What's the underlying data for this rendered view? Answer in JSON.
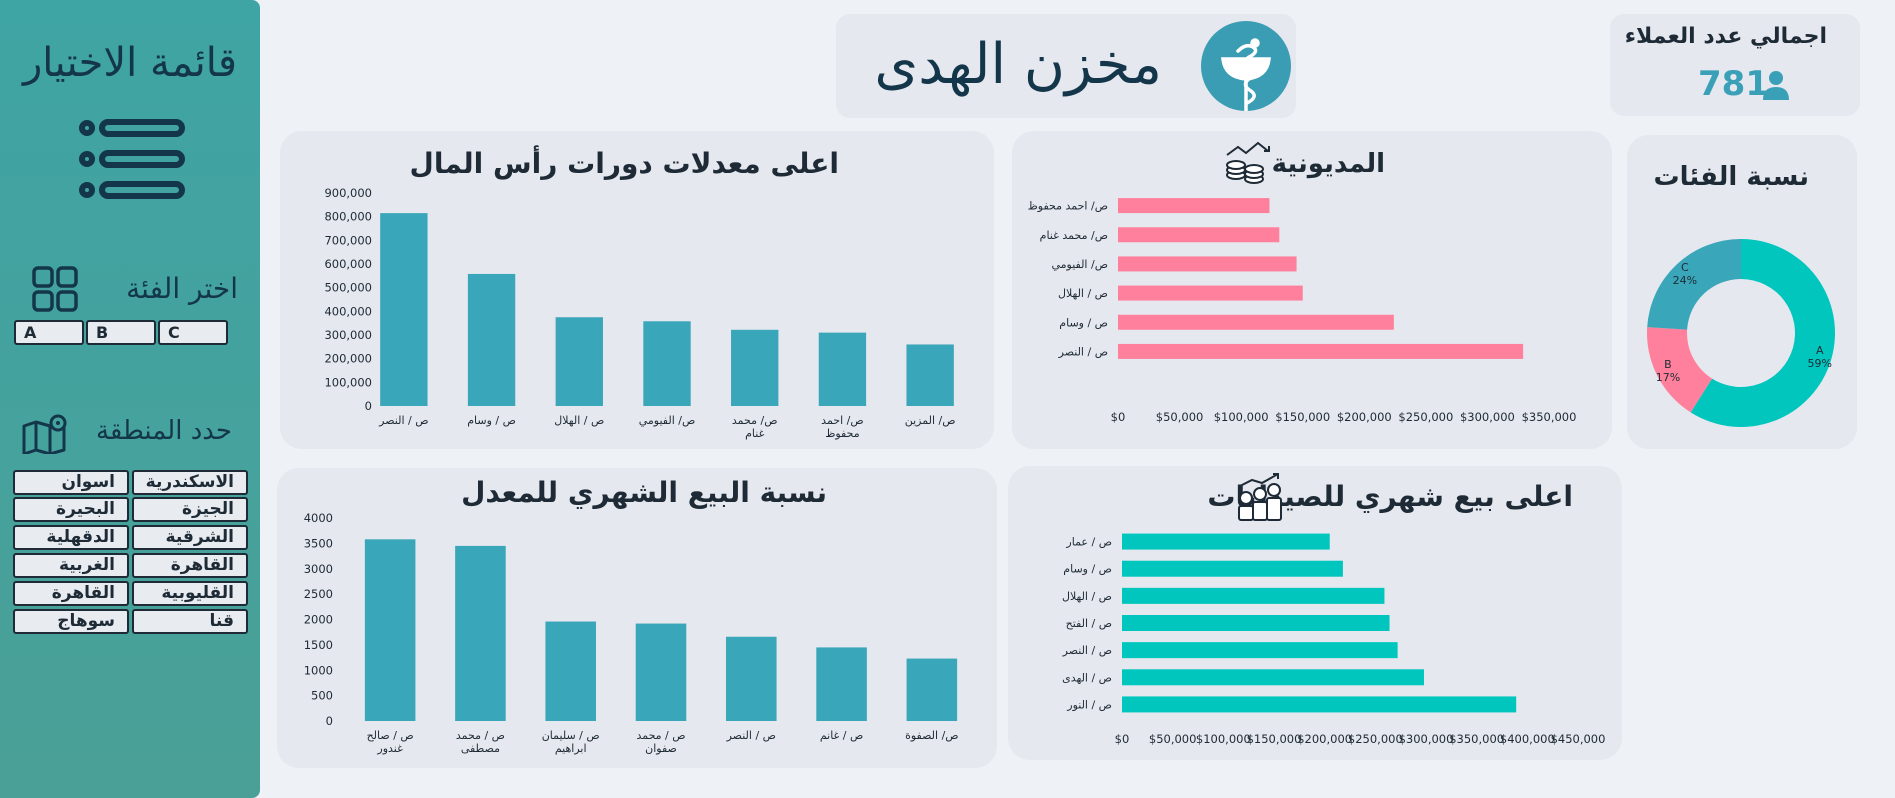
{
  "sidebar": {
    "title": "قائمة الاختيار",
    "category_title": "اختر الفئة",
    "categories": [
      "A",
      "B",
      "C"
    ],
    "region_title": "حدد المنطقة",
    "regions": [
      [
        "الاسكندرية",
        "اسوان"
      ],
      [
        "الجيزة",
        "البحيرة"
      ],
      [
        "الشرقية",
        "الدقهلية"
      ],
      [
        "القاهرة",
        "الغربية"
      ],
      [
        "القليوبية",
        "القاهرة"
      ],
      [
        "قنا",
        "سوهاج"
      ]
    ]
  },
  "header": {
    "title": "مخزن الهدى"
  },
  "kpi": {
    "label": "اجمالي عدد العملاء",
    "value": "781"
  },
  "colors": {
    "teal": "#3aa6b9",
    "pink": "#ff809c",
    "mint": "#00c6be",
    "sidebar": "#45a39d"
  },
  "chart_data": [
    {
      "id": "capital",
      "type": "bar",
      "title": "اعلى معدلات دورات رأس  المال",
      "categories": [
        "ص / النصر",
        "ص / وسام",
        "ص / الهلال",
        "ص/ الفيومي",
        "ص/ محمد غنام",
        "ص/ احمد محفوظ",
        "ص/ المزين"
      ],
      "values": [
        815000,
        558000,
        375000,
        358000,
        322000,
        310000,
        260000
      ],
      "ylim": [
        0,
        900000
      ],
      "yticks": [
        "0",
        "100,000",
        "200,000",
        "300,000",
        "400,000",
        "500,000",
        "600,000",
        "700,000",
        "800,000",
        "900,000"
      ],
      "color": "#3aa6b9"
    },
    {
      "id": "debt",
      "type": "bar",
      "orientation": "horizontal",
      "title": "المديونية",
      "categories": [
        "ص/ احمد محفوظ",
        "ص/ محمد غنام",
        "ص/ الفيومي",
        "ص / الهلال",
        "ص / وسام",
        "ص / النصر"
      ],
      "values": [
        123000,
        131000,
        145000,
        150000,
        224000,
        329000
      ],
      "xlim": [
        0,
        350000
      ],
      "xticks": [
        "$0",
        "$50,000",
        "$100,000",
        "$150,000",
        "$200,000",
        "$250,000",
        "$300,000",
        "$350,000"
      ],
      "color": "#ff809c"
    },
    {
      "id": "categories",
      "type": "pie",
      "title": "نسبة الفئات",
      "labels": [
        "A",
        "B",
        "C"
      ],
      "values": [
        59,
        17,
        24
      ],
      "value_labels": [
        "59%",
        "17%",
        "24%"
      ],
      "colors": [
        "#00c6be",
        "#ff809c",
        "#3aa6b9"
      ]
    },
    {
      "id": "monthly_rate",
      "type": "bar",
      "title": "نسبة البيع الشهري للمعدل",
      "categories": [
        "ص / صالح غندور",
        "ص / محمد مصطفى",
        "ص / سليمان ابراهيم",
        "ص / محمد صفوان",
        "ص / النصر",
        "ص / غانم",
        "ص/ الصفوة"
      ],
      "values": [
        3580,
        3450,
        1960,
        1920,
        1660,
        1450,
        1230
      ],
      "ylim": [
        0,
        4000
      ],
      "yticks": [
        "0",
        "500",
        "1000",
        "1500",
        "2000",
        "2500",
        "3000",
        "3500",
        "4000"
      ],
      "color": "#3aa6b9"
    },
    {
      "id": "pharmacies",
      "type": "bar",
      "orientation": "horizontal",
      "title": "اعلى بيع شهري للصيدليات",
      "categories": [
        "ص / عمار",
        "ص / وسام",
        "ص / الهلال",
        "ص / الفتح",
        "ص / النصر",
        "ص / الهدى",
        "ص / النور"
      ],
      "values": [
        205000,
        218000,
        259000,
        264000,
        272000,
        298000,
        389000
      ],
      "xlim": [
        0,
        450000
      ],
      "xticks": [
        "$0",
        "$50,000",
        "$100,000",
        "$150,000",
        "$200,000",
        "$250,000",
        "$300,000",
        "$350,000",
        "$400,000",
        "$450,000"
      ],
      "color": "#00c6be"
    }
  ]
}
